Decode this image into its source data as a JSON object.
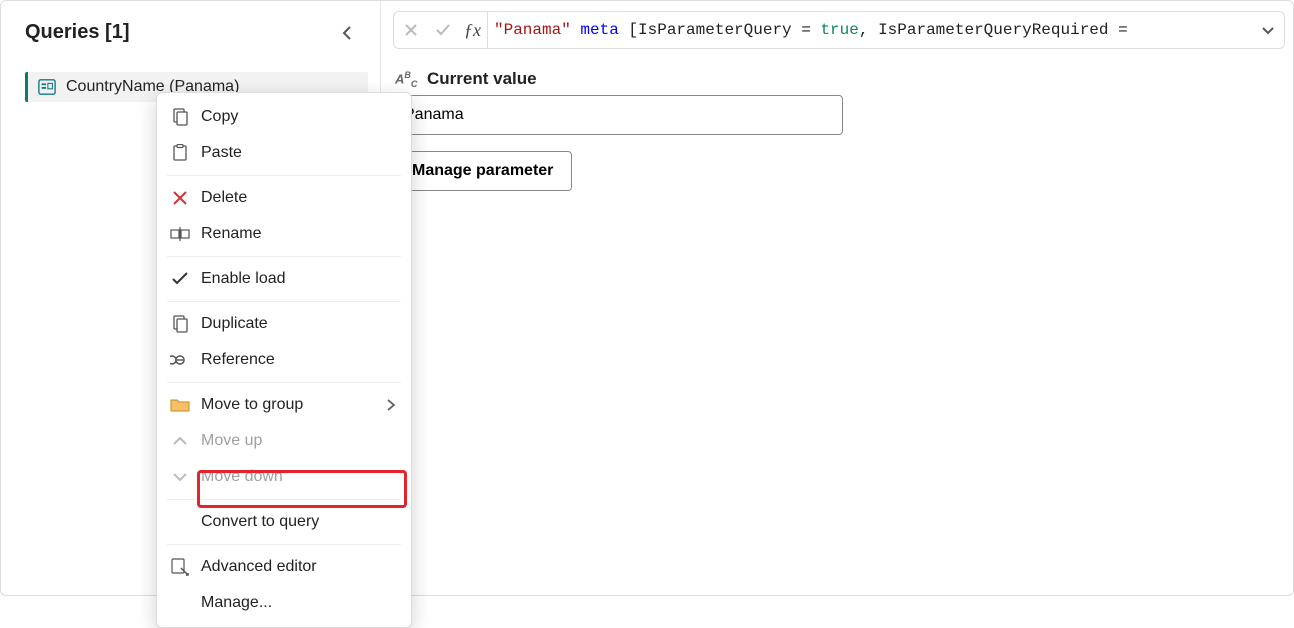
{
  "sidebar": {
    "title": "Queries [1]",
    "items": [
      {
        "label": "CountryName (Panama)"
      }
    ]
  },
  "formula": {
    "s1": "\"Panama\"",
    "s2": " meta ",
    "s3": "[IsParameterQuery = ",
    "s4": "true",
    "s5": ", IsParameterQueryRequired = "
  },
  "main": {
    "current_value_label": "Current value",
    "current_value": "Panama",
    "manage_button": "Manage parameter"
  },
  "context_menu": {
    "copy": "Copy",
    "paste": "Paste",
    "delete": "Delete",
    "rename": "Rename",
    "enable_load": "Enable load",
    "duplicate": "Duplicate",
    "reference": "Reference",
    "move_to_group": "Move to group",
    "move_up": "Move up",
    "move_down": "Move down",
    "convert_to_query": "Convert to query",
    "advanced_editor": "Advanced editor",
    "manage": "Manage..."
  }
}
